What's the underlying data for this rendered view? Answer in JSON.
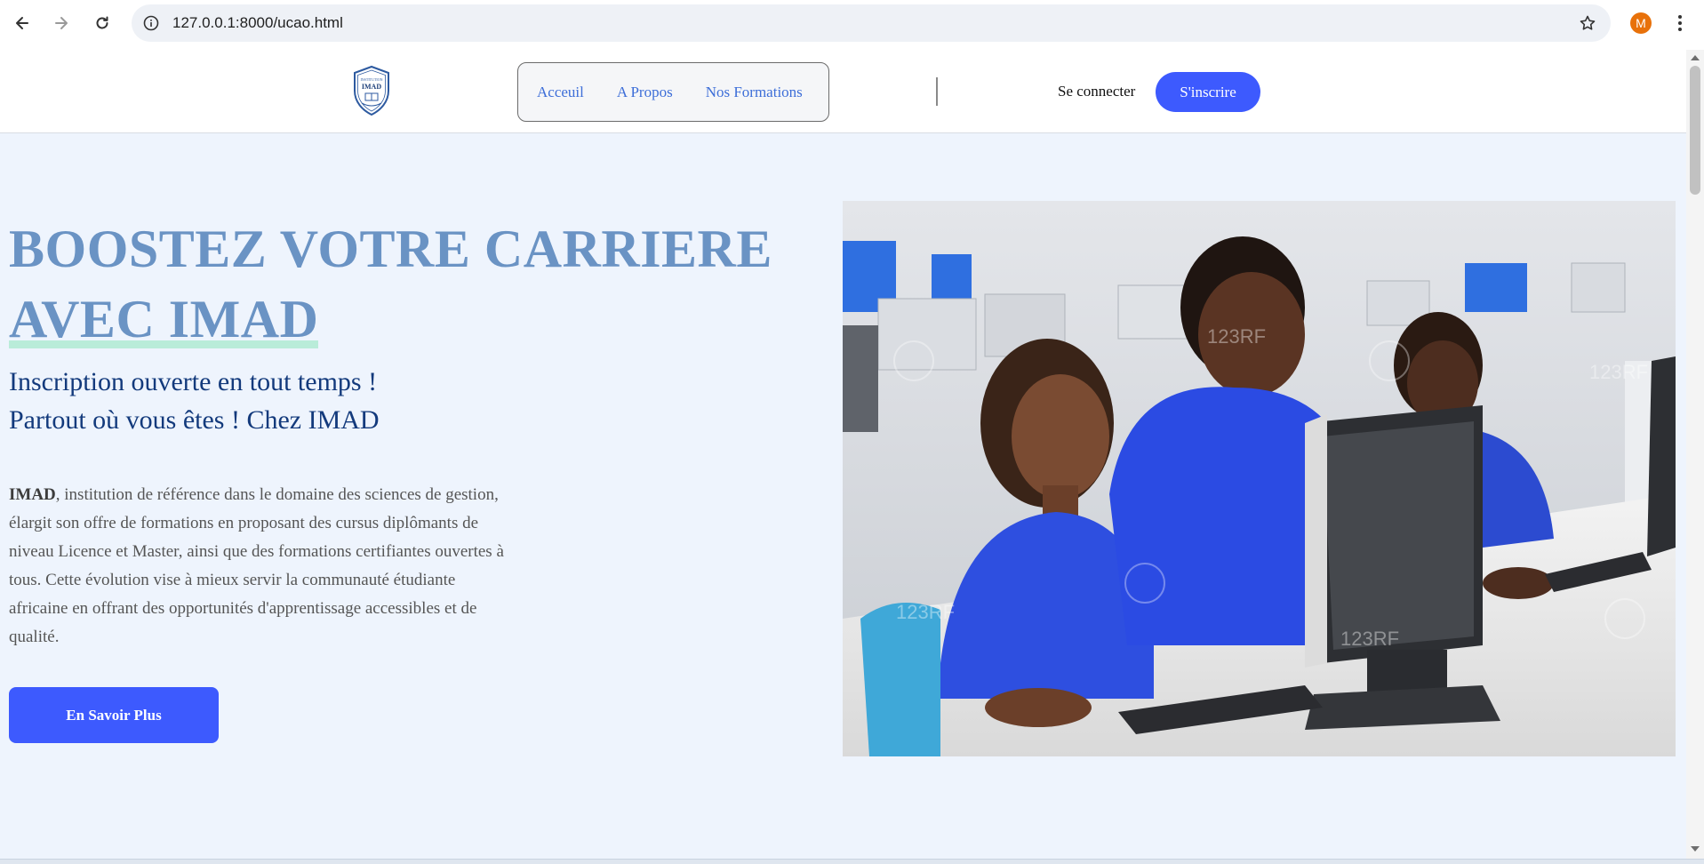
{
  "browser": {
    "url": "127.0.0.1:8000/ucao.html",
    "profile_initial": "M",
    "profile_color": "#e8710a"
  },
  "header": {
    "logo_alt": "IMAD",
    "logo_top_text": "INSTITUTION",
    "logo_main_text": "IMAD",
    "nav": [
      {
        "label": "Acceuil"
      },
      {
        "label": "A Propos"
      },
      {
        "label": "Nos Formations"
      }
    ],
    "login_label": "Se connecter",
    "signup_label": "S'inscrire"
  },
  "hero": {
    "title_line1": "BOOSTEZ VOTRE CARRIERE",
    "title_line2": "AVEC IMAD",
    "subtitle_line1": "Inscription ouverte en tout temps !",
    "subtitle_line2": "Partout où vous êtes ! Chez IMAD",
    "desc_strong": "IMAD",
    "desc_text": ", institution de référence dans le domaine des sciences de gestion, élargit son offre de formations en proposant des cursus diplômants de niveau Licence et Master, ainsi que des formations certifiantes ouvertes à tous. Cette évolution vise à mieux servir la communauté étudiante africaine en offrant des opportunités d'apprentissage accessibles et de qualité.",
    "cta_label": "En Savoir Plus",
    "image_watermark": "123RF"
  },
  "colors": {
    "accent": "#3d5afe",
    "title": "#6a93c4",
    "subtitle": "#133a7c",
    "nav_link": "#3d6ed8",
    "page_bg": "#eef4fd"
  }
}
